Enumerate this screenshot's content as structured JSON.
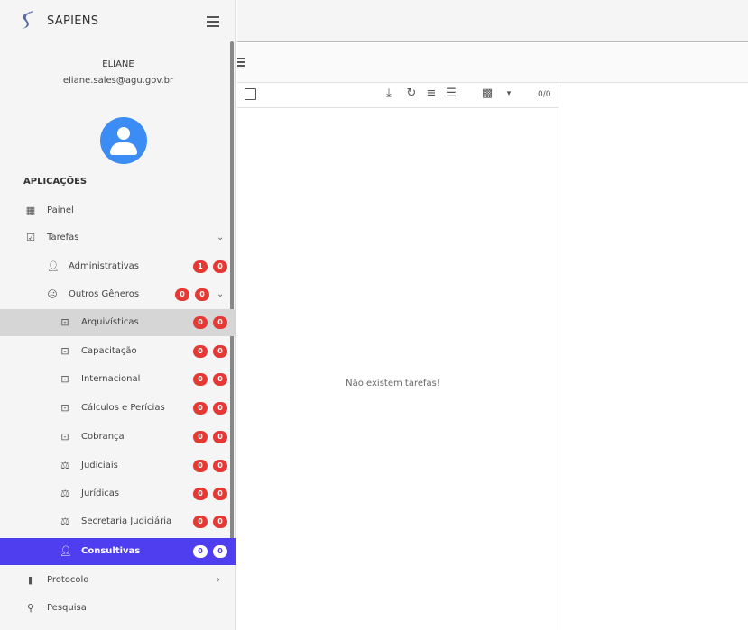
{
  "app": {
    "title": "SAPIENS"
  },
  "user": {
    "name": "ELIANE",
    "email": "eliane.sales@agu.gov.br"
  },
  "sidebar": {
    "section_title": "APLICAÇÕES",
    "items": {
      "painel": {
        "label": "Painel",
        "icon": "dashboard-icon"
      },
      "tarefas": {
        "label": "Tarefas",
        "icon": "checkbox-icon",
        "expanded": true
      },
      "administrativas": {
        "label": "Administrativas",
        "icon": "person-icon",
        "badge1": "1",
        "badge2": "0"
      },
      "outros": {
        "label": "Outros Gêneros",
        "icon": "face-icon",
        "badge1": "0",
        "badge2": "0",
        "expanded": true
      },
      "arquivisticas": {
        "label": "Arquivísticas",
        "icon": "archive-icon",
        "badge1": "0",
        "badge2": "0"
      },
      "capacitacao": {
        "label": "Capacitação",
        "icon": "archive-icon",
        "badge1": "0",
        "badge2": "0"
      },
      "internacional": {
        "label": "Internacional",
        "icon": "archive-icon",
        "badge1": "0",
        "badge2": "0"
      },
      "calculos": {
        "label": "Cálculos e Perícias",
        "icon": "archive-icon",
        "badge1": "0",
        "badge2": "0"
      },
      "cobranca": {
        "label": "Cobrança",
        "icon": "archive-icon",
        "badge1": "0",
        "badge2": "0"
      },
      "judiciais": {
        "label": "Judiciais",
        "icon": "gavel-icon",
        "badge1": "0",
        "badge2": "0"
      },
      "juridicas": {
        "label": "Jurídicas",
        "icon": "gavel-icon",
        "badge1": "0",
        "badge2": "0"
      },
      "secretaria": {
        "label": "Secretaria Judiciária",
        "icon": "gavel-icon",
        "badge1": "0",
        "badge2": "0"
      },
      "consultivas": {
        "label": "Consultivas",
        "icon": "person-icon",
        "badge1": "0",
        "badge2": "0"
      },
      "protocolo": {
        "label": "Protocolo",
        "icon": "book-icon"
      },
      "pesquisa": {
        "label": "Pesquisa",
        "icon": "search-icon"
      }
    }
  },
  "list": {
    "count": "0/0",
    "empty_message": "Não existem tarefas!"
  },
  "colors": {
    "accent": "#4f3df0",
    "badge": "#e53935",
    "avatar": "#3b8cf5"
  }
}
